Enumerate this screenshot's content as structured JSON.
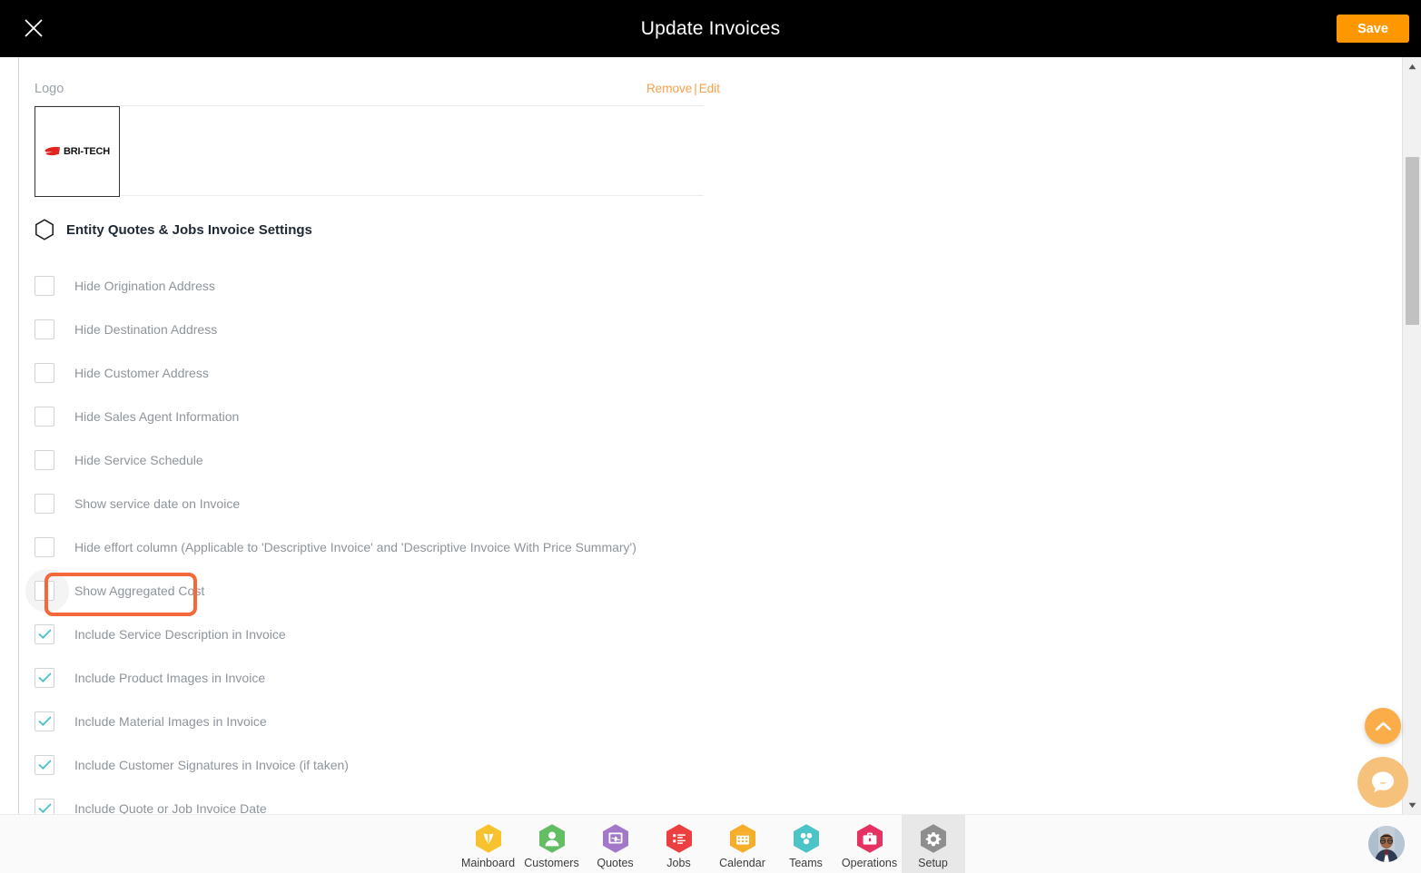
{
  "window": {
    "title": "Update Invoices",
    "close_icon": "close-icon",
    "save_label": "Save",
    "accent_orange": "#ff9800",
    "highlight_orange": "#f4683a",
    "checked_teal": "#4ec3c7"
  },
  "logo_section": {
    "label": "Logo",
    "remove_label": "Remove",
    "separator": "|",
    "edit_label": "Edit",
    "logo_text": "BRI-TECH",
    "logo_mark_icon": "swoosh-icon"
  },
  "section": {
    "icon": "hexagon-icon",
    "title": "Entity Quotes & Jobs Invoice Settings"
  },
  "settings": [
    {
      "label": "Hide Origination Address",
      "checked": false,
      "highlighted": false
    },
    {
      "label": "Hide Destination Address",
      "checked": false,
      "highlighted": false
    },
    {
      "label": "Hide Customer Address",
      "checked": false,
      "highlighted": false
    },
    {
      "label": "Hide Sales Agent Information",
      "checked": false,
      "highlighted": false
    },
    {
      "label": "Hide Service Schedule",
      "checked": false,
      "highlighted": false
    },
    {
      "label": "Show service date on Invoice",
      "checked": false,
      "highlighted": false
    },
    {
      "label": "Hide effort column (Applicable to 'Descriptive Invoice' and 'Descriptive Invoice With Price Summary')",
      "checked": false,
      "highlighted": false
    },
    {
      "label": "Show Aggregated Cost",
      "checked": false,
      "highlighted": true
    },
    {
      "label": "Include Service Description in Invoice",
      "checked": true,
      "highlighted": false
    },
    {
      "label": "Include Product Images in Invoice",
      "checked": true,
      "highlighted": false
    },
    {
      "label": "Include Material Images in Invoice",
      "checked": true,
      "highlighted": false
    },
    {
      "label": "Include Customer Signatures in Invoice (if taken)",
      "checked": true,
      "highlighted": false
    },
    {
      "label": "Include Quote or Job Invoice Date",
      "checked": true,
      "highlighted": false
    }
  ],
  "floating": {
    "scroll_top_icon": "chevron-up-icon",
    "chat_icon": "chat-bubble-icon"
  },
  "scrollbar": {
    "up_icon": "scroll-up-arrow-icon",
    "down_icon": "scroll-down-arrow-icon"
  },
  "nav": [
    {
      "label": "Mainboard",
      "icon": "mainboard-icon",
      "color": "#f8c22e",
      "active": false
    },
    {
      "label": "Customers",
      "icon": "customers-icon",
      "color": "#63bd62",
      "active": false
    },
    {
      "label": "Quotes",
      "icon": "quotes-icon",
      "color": "#a378c8",
      "active": false
    },
    {
      "label": "Jobs",
      "icon": "jobs-icon",
      "color": "#ec3f3f",
      "active": false
    },
    {
      "label": "Calendar",
      "icon": "calendar-icon",
      "color": "#f5ad2a",
      "active": false
    },
    {
      "label": "Teams",
      "icon": "teams-icon",
      "color": "#4cc3c6",
      "active": false
    },
    {
      "label": "Operations",
      "icon": "operations-icon",
      "color": "#e63262",
      "active": false
    },
    {
      "label": "Setup",
      "icon": "gear-icon",
      "color": "#8e8e8e",
      "active": true
    }
  ],
  "avatar": {
    "icon": "user-avatar"
  }
}
